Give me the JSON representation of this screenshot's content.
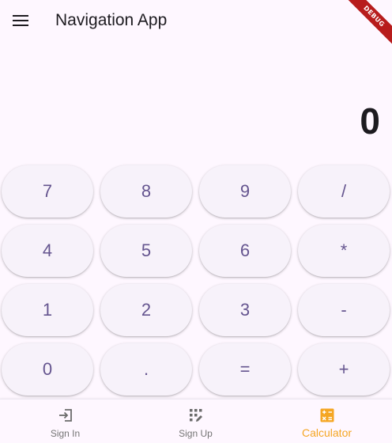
{
  "app_bar": {
    "title": "Navigation App",
    "menu_icon": "hamburger-menu-icon"
  },
  "debug_banner": {
    "label": "DEBUG"
  },
  "display": {
    "value": "0"
  },
  "keypad": {
    "keys": [
      "7",
      "8",
      "9",
      "/",
      "4",
      "5",
      "6",
      "*",
      "1",
      "2",
      "3",
      "-",
      "0",
      ".",
      "=",
      "+"
    ]
  },
  "bottom_nav": {
    "items": [
      {
        "label": "Sign In",
        "icon": "login-icon",
        "active": false
      },
      {
        "label": "Sign Up",
        "icon": "app-registration-icon",
        "active": false
      },
      {
        "label": "Calculator",
        "icon": "calculate-icon",
        "active": true
      }
    ]
  },
  "colors": {
    "background": "#fef7ff",
    "key_text": "#65558f",
    "active_nav": "#f5a623",
    "inactive_nav": "#757575",
    "debug_banner": "#b71c1c"
  }
}
